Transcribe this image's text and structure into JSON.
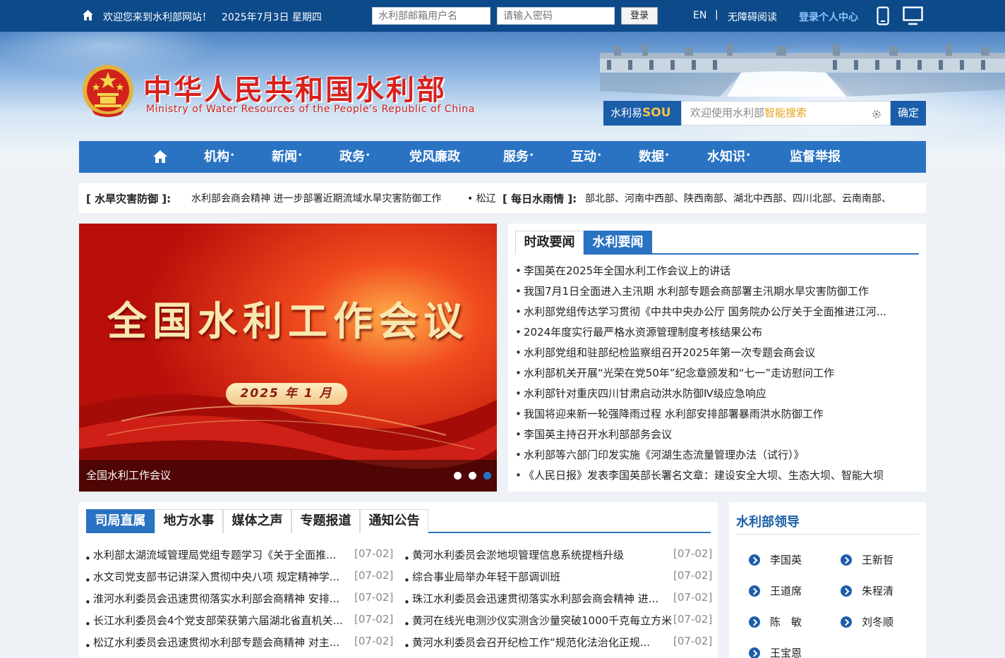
{
  "topbar": {
    "welcome": "欢迎您来到水利部网站！",
    "date": "2025年7月3日 星期四",
    "username_placeholder": "水利部邮箱用户名",
    "password_placeholder": "请输入密码",
    "login_label": "登录",
    "lang": "EN",
    "separator": "|",
    "accessibility": "无障碍阅读",
    "personal_center": "登录个人中心"
  },
  "header": {
    "title": "中华人民共和国水利部",
    "subtitle": "Ministry of Water Resources of the People's Republic of China"
  },
  "search": {
    "brand_prefix": "水利易",
    "brand_mark": "SOU",
    "placeholder_prefix": "欢迎使用水利部",
    "placeholder_highlight": "智能搜索",
    "button": "确定"
  },
  "nav": {
    "items": [
      "机构",
      "新闻",
      "政务",
      "党风廉政",
      "服务",
      "互动",
      "数据",
      "水知识",
      "监督举报"
    ],
    "dropdown_mark": "•"
  },
  "ticker": {
    "label1": "[ 水旱灾害防御 ]:",
    "text1": "水利部会商会精神 进一步部署近期流域水旱灾害防御工作",
    "extra1": "• 松辽",
    "label2": "[ 每日水雨情 ]:",
    "text2": "部北部、河南中西部、陕西南部、湖北中西部、四川北部、云南南部、"
  },
  "slider": {
    "headline": "全国水利工作会议",
    "date_pill": "2025 年 1 月",
    "caption": "全国水利工作会议"
  },
  "news": {
    "tabs": [
      "时政要闻",
      "水利要闻"
    ],
    "active_tab": 1,
    "items": [
      "李国英在2025年全国水利工作会议上的讲话",
      "我国7月1日全面进入主汛期 水利部专题会商部署主汛期水旱灾害防御工作",
      "水利部党组传达学习贯彻《中共中央办公厅 国务院办公厅关于全面推进江河...",
      "2024年度实行最严格水资源管理制度考核结果公布",
      "水利部党组和驻部纪检监察组召开2025年第一次专题会商会议",
      "水利部机关开展“光荣在党50年”纪念章颁发和“七一”走访慰问工作",
      "水利部针对重庆四川甘肃启动洪水防御Ⅳ级应急响应",
      "我国将迎来新一轮强降雨过程 水利部安排部署暴雨洪水防御工作",
      "李国英主持召开水利部部务会议",
      "水利部等六部门印发实施《河湖生态流量管理办法（试行）》",
      "《人民日报》发表李国英部长署名文章：建设安全大坝、生态大坝、智能大坝"
    ]
  },
  "bureau": {
    "tabs": [
      "司局直属",
      "地方水事",
      "媒体之声",
      "专题报道",
      "通知公告"
    ],
    "active_tab": 0,
    "left": [
      {
        "title": "水利部太湖流域管理局党组专题学习《关于全面推...",
        "date": "[07-02]"
      },
      {
        "title": "水文司党支部书记讲深入贯彻中央八项 规定精神学...",
        "date": "[07-02]"
      },
      {
        "title": "淮河水利委员会迅速贯彻落实水利部会商精神 安排...",
        "date": "[07-02]"
      },
      {
        "title": "长江水利委员会4个党支部荣获第六届湖北省直机关...",
        "date": "[07-02]"
      },
      {
        "title": "松辽水利委员会迅速贯彻水利部专题会商精神 对主...",
        "date": "[07-02]"
      }
    ],
    "right": [
      {
        "title": "黄河水利委员会淤地坝管理信息系统提档升级",
        "date": "[07-02]"
      },
      {
        "title": "综合事业局举办年轻干部调训班",
        "date": "[07-02]"
      },
      {
        "title": "珠江水利委员会迅速贯彻落实水利部会商会精神 进...",
        "date": "[07-02]"
      },
      {
        "title": "黄河在线光电测沙仪实测含沙量突破1000千克每立方米",
        "date": "[07-02]"
      },
      {
        "title": "黄河水利委员会召开纪检工作“规范化法治化正规...",
        "date": "[07-02]"
      }
    ]
  },
  "leaders": {
    "title": "水利部领导",
    "names": [
      "李国英",
      "王新哲",
      "王道席",
      "朱程清",
      "陈　敏",
      "刘冬顺",
      "王宝恩"
    ]
  },
  "colors": {
    "topbar": "#0d4a8a",
    "nav": "#2a73c2",
    "title_red": "#d8201c",
    "accent_gold": "#e7a21c"
  }
}
